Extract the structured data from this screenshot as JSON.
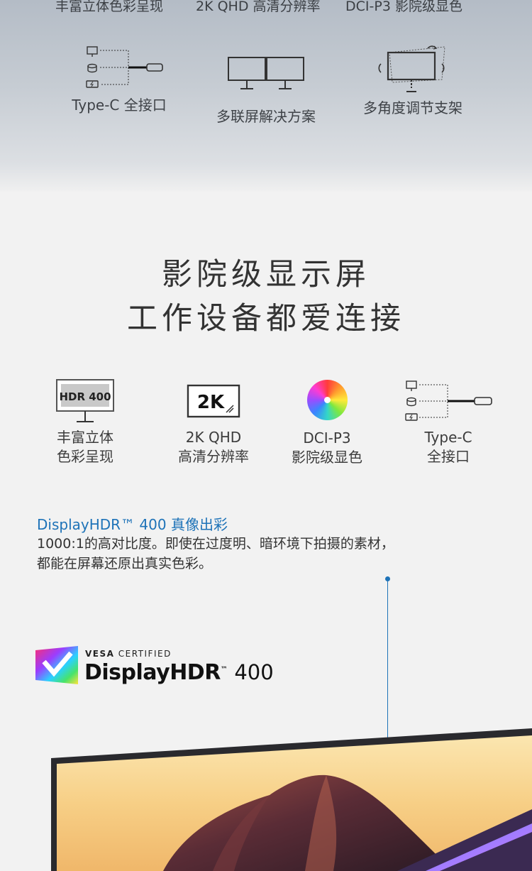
{
  "top_labels": [
    "丰富立体色彩呈现",
    "2K QHD 高清分辨率",
    "DCI-P3 影院级显色"
  ],
  "top_features": [
    {
      "icon": "type-c-port-icon",
      "label": "Type-C 全接口"
    },
    {
      "icon": "dual-monitor-icon",
      "label": "多联屏解决方案"
    },
    {
      "icon": "rotating-monitor-icon",
      "label": "多角度调节支架"
    }
  ],
  "headline": {
    "line1": "影院级显示屏",
    "line2": "工作设备都爱连接"
  },
  "features": [
    {
      "icon": "hdr-monitor-icon",
      "icon_text": "HDR 400",
      "line1": "丰富立体",
      "line2": "色彩呈现"
    },
    {
      "icon": "2k-badge-icon",
      "icon_text": "2K",
      "line1": "2K QHD",
      "line2": "高清分辨率"
    },
    {
      "icon": "color-wheel-icon",
      "line1": "DCI-P3",
      "line2": "影院级显色"
    },
    {
      "icon": "type-c-port-icon",
      "line1": "Type-C",
      "line2": "全接口"
    }
  ],
  "hdr_section": {
    "title": "DisplayHDR™ 400 真像出彩",
    "text_line1": "1000:1的高对比度。即使在过度明、暗环境下拍摄的素材，",
    "text_line2": "都能在屏幕还原出真实色彩。"
  },
  "vesa_logo": {
    "vesa": "VESA",
    "certified": "CERTIFIED",
    "display": "Display",
    "hdr": "HDR",
    "tm": "™",
    "number": "400"
  },
  "colors": {
    "accent_blue": "#1e73b8",
    "text_dark": "#333333"
  }
}
